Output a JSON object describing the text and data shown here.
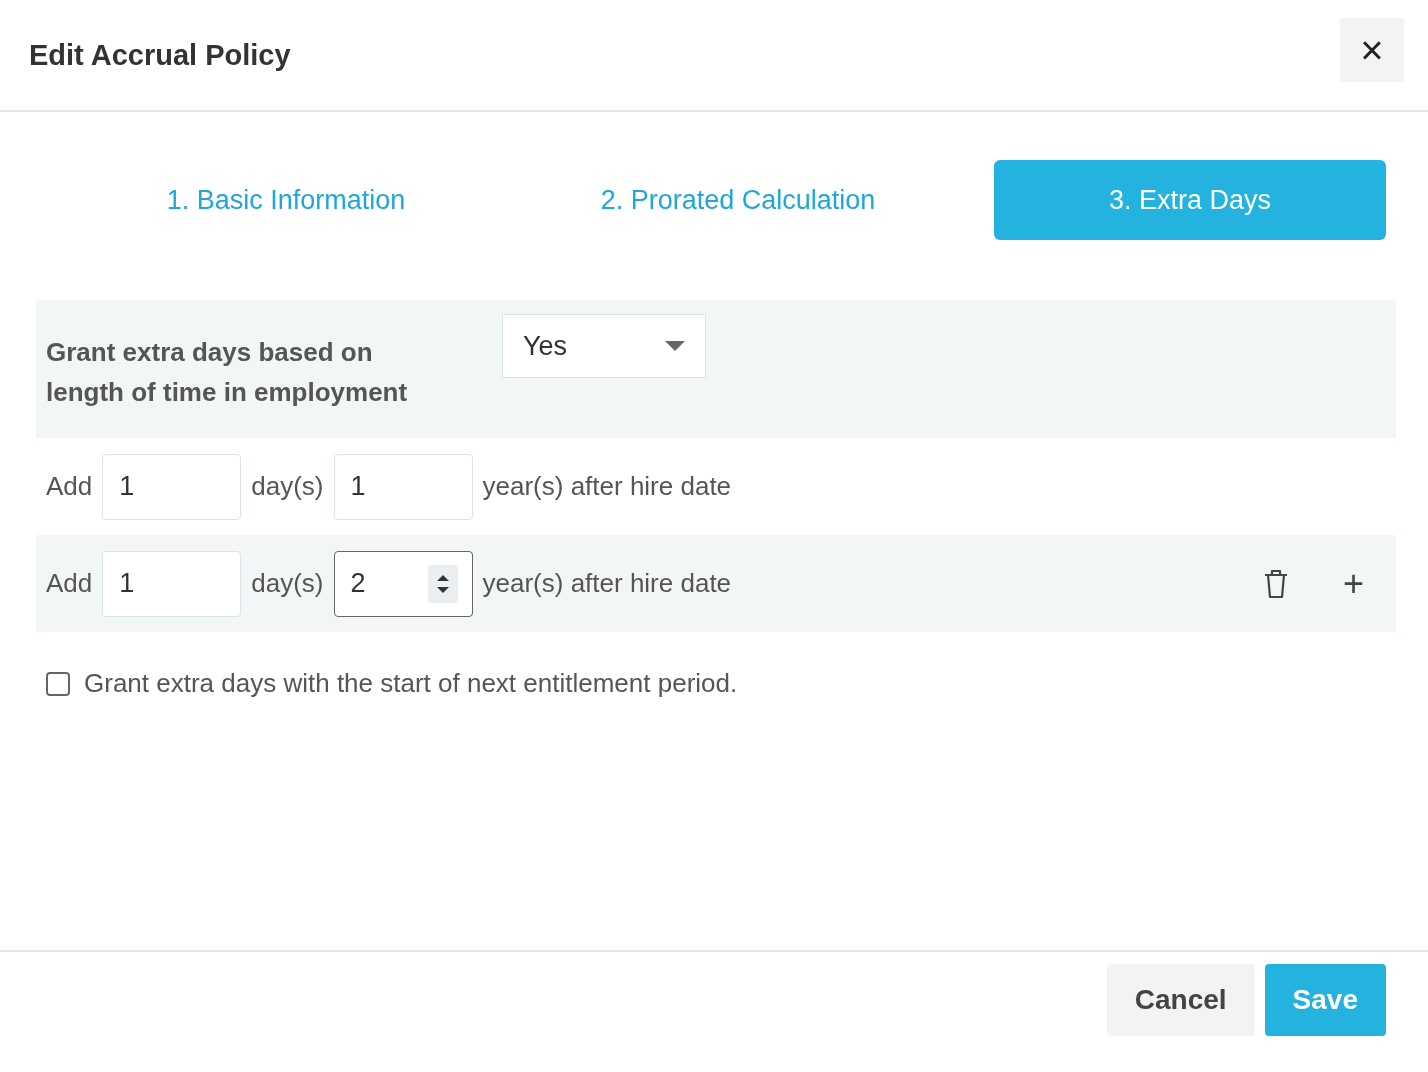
{
  "dialog": {
    "title": "Edit Accrual Policy",
    "close": "×"
  },
  "tabs": [
    {
      "label": "1. Basic Information",
      "selected": false
    },
    {
      "label": "2. Prorated Calculation",
      "selected": false
    },
    {
      "label": "3. Extra Days",
      "selected": true
    }
  ],
  "grant": {
    "label": "Grant extra days based on length of time in employment",
    "value": "Yes"
  },
  "rows": [
    {
      "add": "Add",
      "days": "1",
      "days_unit": "day(s)",
      "years": "1",
      "years_focused": false,
      "suffix": "year(s) after hire date",
      "show_actions": false
    },
    {
      "add": "Add",
      "days": "1",
      "days_unit": "day(s)",
      "years": "2",
      "years_focused": true,
      "suffix": "year(s) after hire date",
      "show_actions": true,
      "add_icon": "+"
    }
  ],
  "next_period": {
    "label": "Grant extra days with the start of next entitlement period.",
    "checked": false
  },
  "buttons": [
    {
      "label": "Cancel",
      "kind": "secondary"
    },
    {
      "label": "Save",
      "kind": "primary"
    }
  ]
}
